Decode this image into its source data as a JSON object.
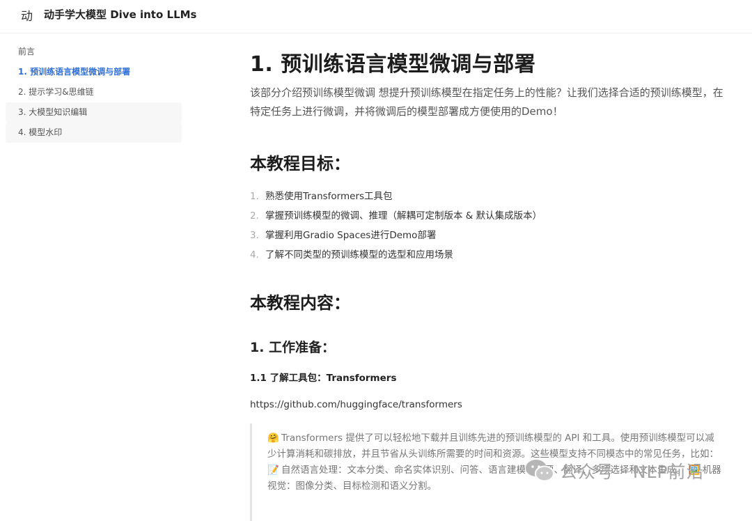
{
  "header": {
    "logo_char": "动",
    "title": "动手学大模型 Dive into LLMs"
  },
  "sidebar": {
    "items": [
      {
        "label": "前言"
      },
      {
        "label": "1. 预训练语言模型微调与部署"
      },
      {
        "label": "2. 提示学习&思维链"
      },
      {
        "label": "3. 大模型知识编辑"
      },
      {
        "label": "4. 模型水印"
      }
    ]
  },
  "main": {
    "title": "1. 预训练语言模型微调与部署",
    "intro": "该部分介绍预训练模型微调 想提升预训练模型在指定任务上的性能？让我们选择合适的预训练模型，在特定任务上进行微调，并将微调后的模型部署成方便使用的Demo！",
    "goals_title": "本教程目标：",
    "goals": [
      {
        "num": "1.",
        "text": "熟悉使用Transformers工具包"
      },
      {
        "num": "2.",
        "text": "掌握预训练模型的微调、推理（解耦可定制版本 & 默认集成版本）"
      },
      {
        "num": "3.",
        "text": "掌握利用Gradio Spaces进行Demo部署"
      },
      {
        "num": "4.",
        "text": "了解不同类型的预训练模型的选型和应用场景"
      }
    ],
    "content_title": "本教程内容：",
    "section1_title": "1. 工作准备：",
    "section1_1_title": "1.1 了解工具包：Transformers",
    "url": "https://github.com/huggingface/transformers",
    "quote": {
      "line1_emoji": "🤗",
      "line1": "Transformers 提供了可以轻松地下载并且训练先进的预训练模型的 API 和工具。使用预训练模型可以减少计算消耗和碳排放，并且节省从头训练所需要的时间和资源。这些模型支持不同模态中的常见任务，比如：",
      "line2_emoji": "📝",
      "line2": "自然语言处理：文本分类、命名实体识别、问答、语言建模、摘要、翻译、多项选择和文本生成。",
      "line3_emoji": "🖼️",
      "line3": "机器视觉：图像分类、目标检测和语义分割。"
    }
  },
  "watermark": {
    "text": "公众号 · NLP前沿"
  }
}
